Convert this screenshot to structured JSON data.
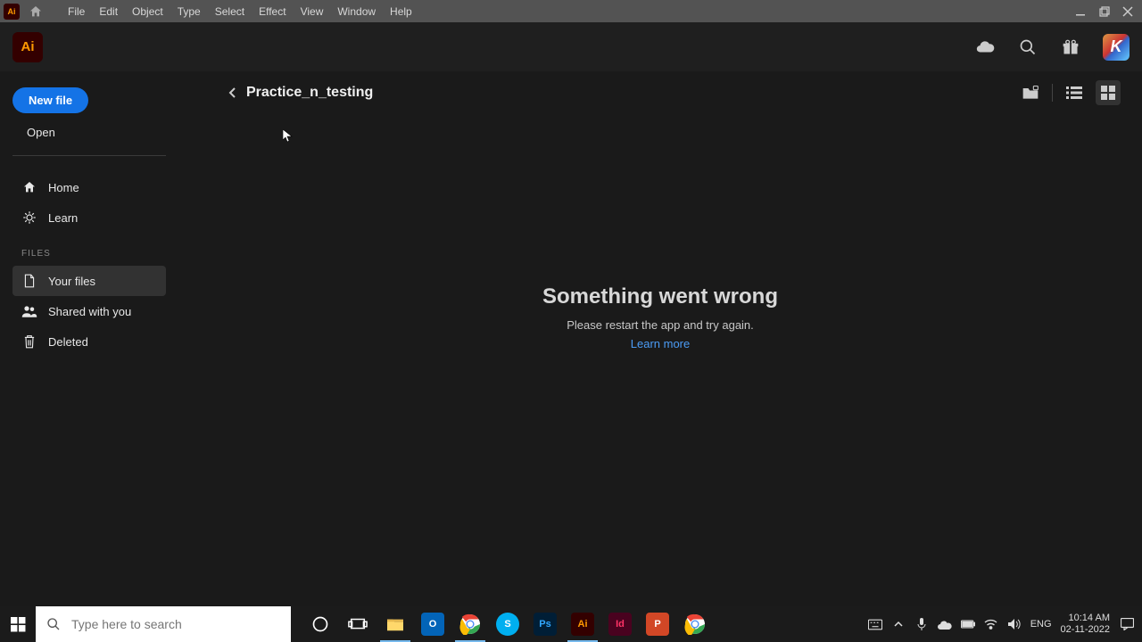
{
  "titlebar": {
    "app_badge": "Ai",
    "menus": [
      "File",
      "Edit",
      "Object",
      "Type",
      "Select",
      "Effect",
      "View",
      "Window",
      "Help"
    ]
  },
  "header": {
    "logo": "Ai",
    "avatar_letter": "K"
  },
  "sidebar": {
    "new_file": "New file",
    "open": "Open",
    "nav": [
      {
        "label": "Home"
      },
      {
        "label": "Learn"
      }
    ],
    "section": "FILES",
    "files_nav": [
      {
        "label": "Your files"
      },
      {
        "label": "Shared with you"
      },
      {
        "label": "Deleted"
      }
    ]
  },
  "content": {
    "breadcrumb": "Practice_n_testing",
    "error_title": "Something went wrong",
    "error_msg": "Please restart the app and try again.",
    "error_link": "Learn more"
  },
  "taskbar": {
    "search_placeholder": "Type here to search",
    "lang": "ENG",
    "time": "10:14 AM",
    "date": "02-11-2022"
  }
}
